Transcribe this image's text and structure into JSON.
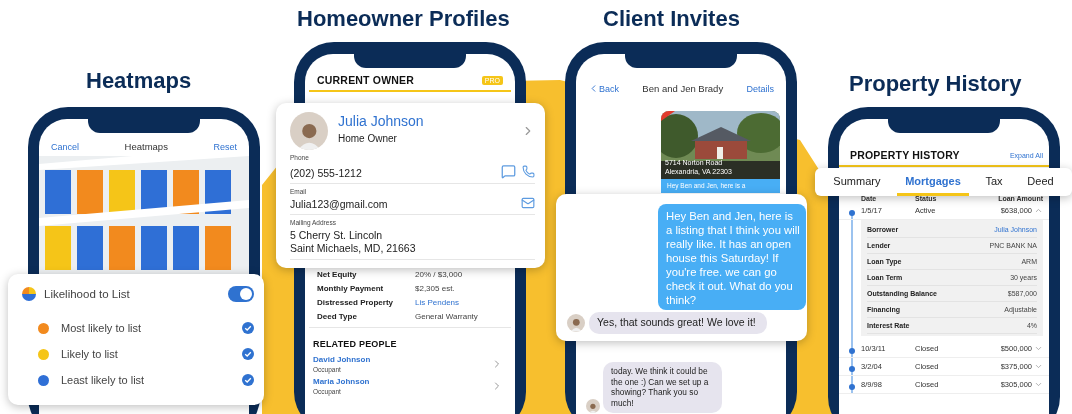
{
  "heatmaps": {
    "heading": "Heatmaps",
    "nav": {
      "left": "Cancel",
      "title": "Heatmaps",
      "right": "Reset"
    },
    "layer": {
      "title": "Likelihood to List",
      "on": true
    },
    "legend": [
      {
        "label": "Most likely to list",
        "color": "#f28a1e",
        "checked": true
      },
      {
        "label": "Likely to list",
        "color": "#f5c518",
        "checked": true
      },
      {
        "label": "Least likely to list",
        "color": "#2f6fd6",
        "checked": true
      }
    ]
  },
  "homeowner_profiles": {
    "heading": "Homeowner Profiles",
    "section_title": "CURRENT OWNER",
    "badge": "PRO",
    "owner": {
      "name": "Julia Johnson",
      "role": "Home Owner",
      "phone_label": "Phone",
      "phone": "(202) 555-1212",
      "email_label": "Email",
      "email": "Julia123@gmail.com",
      "address_label": "Mailing Address",
      "address_lines": [
        "5 Cherry St. Lincoln",
        "Saint Michaels, MD, 21663"
      ]
    },
    "details": [
      {
        "label": "Net Equity",
        "value": "20% / $3,000",
        "kind": "text"
      },
      {
        "label": "Monthly Payment",
        "value": "$2,305 est.",
        "kind": "text"
      },
      {
        "label": "Distressed Property",
        "value": "Lis Pendens",
        "kind": "link"
      },
      {
        "label": "Deed Type",
        "value": "General Warranty",
        "kind": "text"
      }
    ],
    "related_title": "RELATED PEOPLE",
    "related": [
      {
        "name": "David Johnson",
        "role": "Occupant"
      },
      {
        "name": "Maria Johnson",
        "role": "Occupant"
      }
    ]
  },
  "client_invites": {
    "heading": "Client Invites",
    "nav": {
      "back": "Back",
      "title": "Ben and Jen Brady",
      "right": "Details"
    },
    "listing": {
      "address_lines": [
        "5714 Norton Road",
        "Alexandria, VA 22303"
      ],
      "preview": "Hey Ben and Jen, here is a"
    },
    "messages": [
      {
        "kind": "sent",
        "text": "Hey Ben and Jen, here is a listing that I think you will really like. It has an open house this Saturday! If you're free. we can go check it out. What do you think?"
      },
      {
        "kind": "received",
        "text": "Yes, that sounds great! We love it!"
      }
    ],
    "later_message": {
      "text": "today. We think it could be the one :) Can we set up a showing? Thank you so much!"
    }
  },
  "property_history": {
    "heading": "Property History",
    "title": "PROPERTY HISTORY",
    "action": "Expand All",
    "tabs": [
      {
        "label": "Summary",
        "selected": false
      },
      {
        "label": "Mortgages",
        "selected": true
      },
      {
        "label": "Tax",
        "selected": false
      },
      {
        "label": "Deed",
        "selected": false
      }
    ],
    "columns": [
      "Date",
      "Status",
      "Loan Amount"
    ],
    "rows": [
      {
        "date": "1/5/17",
        "status": "Active",
        "amount": "$638,000",
        "expanded": true,
        "details": [
          {
            "label": "Borrower",
            "value": "Julia Johnson",
            "kind": "link"
          },
          {
            "label": "Lender",
            "value": "PNC BANK NA",
            "kind": "text"
          },
          {
            "label": "Loan Type",
            "value": "ARM",
            "kind": "text"
          },
          {
            "label": "Loan Term",
            "value": "30 years",
            "kind": "text"
          },
          {
            "label": "Outstanding Balance",
            "value": "$587,000",
            "kind": "text"
          },
          {
            "label": "Financing",
            "value": "Adjustable",
            "kind": "text"
          },
          {
            "label": "Interest Rate",
            "value": "4%",
            "kind": "text"
          }
        ]
      },
      {
        "date": "10/3/11",
        "status": "Closed",
        "amount": "$500,000",
        "expanded": false
      },
      {
        "date": "3/2/04",
        "status": "Closed",
        "amount": "$375,000",
        "expanded": false
      },
      {
        "date": "8/9/98",
        "status": "Closed",
        "amount": "$305,000",
        "expanded": false
      }
    ]
  }
}
